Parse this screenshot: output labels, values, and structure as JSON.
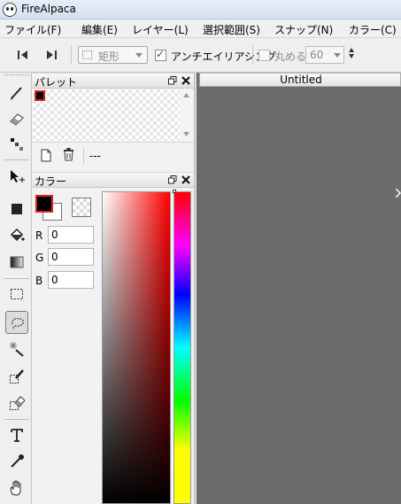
{
  "window": {
    "title": "FireAlpaca"
  },
  "menu": [
    {
      "label": "ファイル(F)"
    },
    {
      "label": "編集(E)"
    },
    {
      "label": "レイヤー(L)"
    },
    {
      "label": "選択範囲(S)"
    },
    {
      "label": "スナップ(N)"
    },
    {
      "label": "カラー(C)"
    }
  ],
  "toolbar": {
    "shape_select": "矩形",
    "antialias_label": "アンチエイリアシング",
    "antialias_checked": true,
    "round_label": "丸める",
    "round_checked": false,
    "round_value": "60"
  },
  "palette_panel": {
    "title": "パレット",
    "dash_text": "---"
  },
  "color_panel": {
    "title": "カラー",
    "fg_color": "#000000",
    "r_label": "R",
    "r_value": "0",
    "g_label": "G",
    "g_value": "0",
    "b_label": "B",
    "b_value": "0"
  },
  "canvas": {
    "tab_title": "Untitled",
    "background": "#6b6b6b"
  },
  "tools": [
    "pen-icon",
    "eraser-icon",
    "dot-icon",
    "move-icon",
    "fill-rect-icon",
    "bucket-icon",
    "gradient-icon",
    "rect-select-icon",
    "lasso-select-icon",
    "magic-wand-icon",
    "select-pen-icon",
    "select-eraser-icon",
    "text-icon",
    "eyedropper-icon",
    "hand-icon"
  ],
  "colors": {
    "accent_red": "#e02020",
    "canvas_gray": "#6b6b6b"
  }
}
